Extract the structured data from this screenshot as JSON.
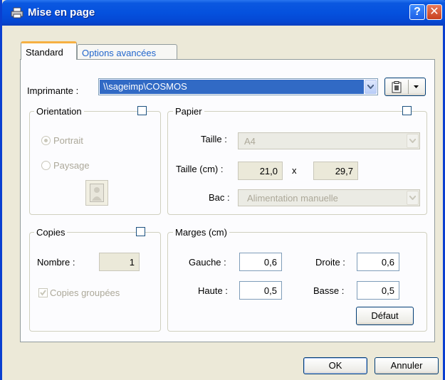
{
  "window": {
    "title": "Mise en page",
    "help_label": "?",
    "close_label": "✕"
  },
  "tabs": [
    {
      "label": "Standard",
      "active": true
    },
    {
      "label": "Options avancées",
      "active": false
    }
  ],
  "printer": {
    "label": "Imprimante :",
    "value": "\\\\sageimp\\COSMOS"
  },
  "orientation": {
    "title": "Orientation",
    "portrait_label": "Portrait",
    "paysage_label": "Paysage",
    "selected": "Portrait"
  },
  "paper": {
    "title": "Papier",
    "size_label": "Taille :",
    "size_value": "A4",
    "size_cm_label": "Taille (cm) :",
    "width": "21,0",
    "times": "x",
    "height": "29,7",
    "tray_label": "Bac :",
    "tray_value": "Alimentation manuelle"
  },
  "copies": {
    "title": "Copies",
    "number_label": "Nombre :",
    "number_value": "1",
    "collate_label": "Copies groupées",
    "collate_checked": true
  },
  "margins": {
    "title": "Marges (cm)",
    "left_label": "Gauche :",
    "left_value": "0,6",
    "right_label": "Droite :",
    "right_value": "0,6",
    "top_label": "Haute :",
    "top_value": "0,5",
    "bottom_label": "Basse :",
    "bottom_value": "0,5",
    "default_button": "Défaut"
  },
  "footer": {
    "ok_label": "OK",
    "cancel_label": "Annuler"
  },
  "colors": {
    "titlebar": "#0551de",
    "selection": "#316ac5",
    "tab_accent": "#f6b042"
  }
}
